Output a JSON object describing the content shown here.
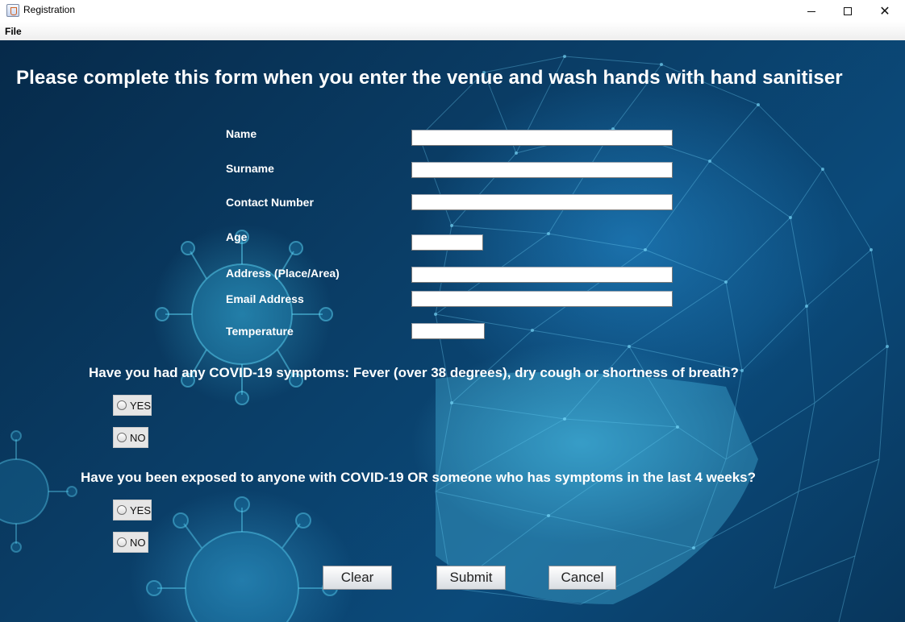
{
  "window": {
    "title": "Registration",
    "icon": "java-cup-icon",
    "controls": [
      "minimize-icon",
      "maximize-icon",
      "close-icon"
    ]
  },
  "menu": {
    "file": "File"
  },
  "form": {
    "heading": "Please complete this form when you enter the venue and wash hands with hand sanitiser",
    "fields": {
      "name": {
        "label": "Name",
        "value": ""
      },
      "surname": {
        "label": "Surname",
        "value": ""
      },
      "contact": {
        "label": "Contact Number",
        "value": ""
      },
      "age": {
        "label": "Age",
        "value": ""
      },
      "address": {
        "label": "Address (Place/Area)",
        "value": ""
      },
      "email": {
        "label": "Email Address",
        "value": ""
      },
      "temperature": {
        "label": "Temperature",
        "value": ""
      }
    },
    "q1": {
      "text": "Have you had any COVID-19 symptoms: Fever (over 38 degrees), dry cough or shortness of breath?",
      "yes": "YES",
      "no": "NO"
    },
    "q2": {
      "text": "Have you been exposed to anyone with COVID-19 OR someone who has symptoms in the last 4 weeks?",
      "yes": "YES",
      "no": "NO"
    },
    "buttons": {
      "clear": "Clear",
      "submit": "Submit",
      "cancel": "Cancel"
    }
  },
  "colors": {
    "background": "#0a3d66",
    "text": "#ffffff",
    "accent": "#3fb4e6"
  }
}
